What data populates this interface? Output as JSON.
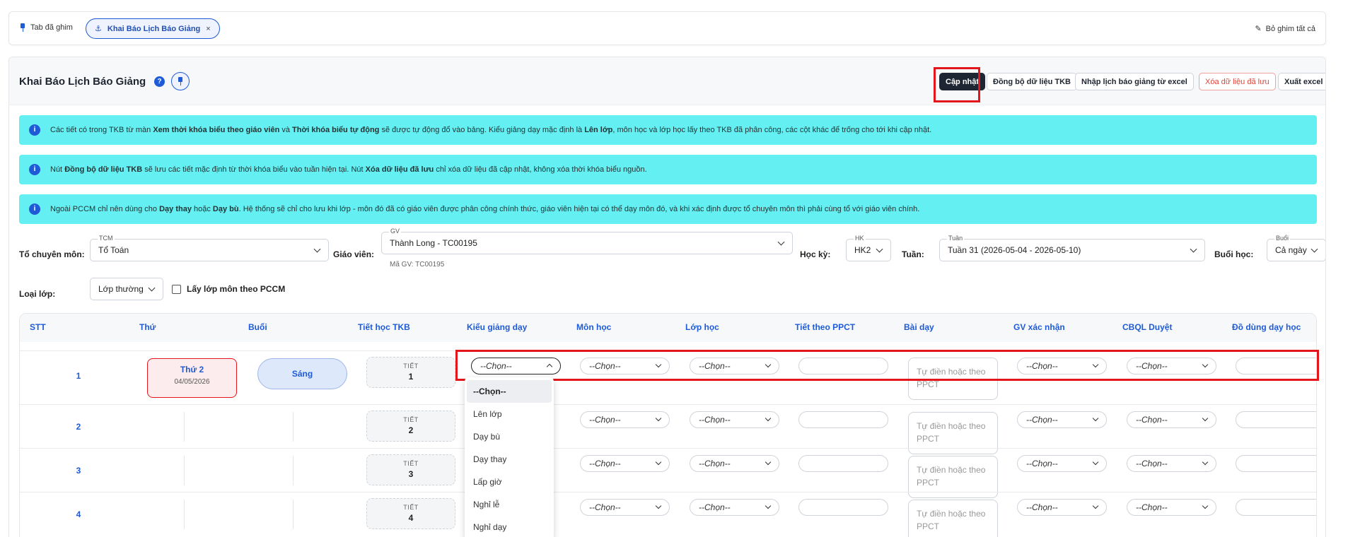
{
  "pinbar": {
    "label": "Tab đã ghim",
    "tab": "Khai Báo Lịch Báo Giảng",
    "tab_close": "×",
    "unpin_all": "Bỏ ghim tất cả"
  },
  "header": {
    "title": "Khai Báo Lịch Báo Giảng",
    "help": "?",
    "buttons": {
      "update": "Cập nhật",
      "sync": "Đồng bộ dữ liệu TKB",
      "import": "Nhập lịch báo giảng từ excel",
      "delete": "Xóa dữ liệu đã lưu",
      "export": "Xuất excel"
    }
  },
  "notices": [
    {
      "t1": "Các tiết có trong TKB từ màn ",
      "b1": "Xem thời khóa biểu theo giáo viên",
      "t2": " và ",
      "b2": "Thời khóa biểu tự động",
      "t3": " sẽ được tự động đổ vào bảng. Kiểu giảng dạy mặc định là ",
      "b3": "Lên lớp",
      "t4": ", môn học và lớp học lấy theo TKB đã phân công, các cột khác để trống cho tới khi cập nhật."
    },
    {
      "t1": "Nút ",
      "b1": "Đồng bộ dữ liệu TKB",
      "t2": " sẽ lưu các tiết mặc định từ thời khóa biểu vào tuần hiện tại. Nút ",
      "b2": "Xóa dữ liệu đã lưu",
      "t3": " chỉ xóa dữ liệu đã cập nhật, không xóa thời khóa biểu nguồn."
    },
    {
      "t1": "Ngoài PCCM chỉ nên dùng cho ",
      "b1": "Dạy thay",
      "t2": " hoặc ",
      "b2": "Dạy bù",
      "t3": ". Hệ thống sẽ chỉ cho lưu khi lớp - môn đó đã có giáo viên được phân công chính thức, giáo viên hiện tại có thể dạy môn đó, và khi xác định được tổ chuyên môn thì phải cùng tổ với giáo viên chính."
    }
  ],
  "filters": {
    "tcm_label": "Tổ chuyên môn:",
    "tcm_legend": "TCM",
    "tcm_value": "Tổ Toán",
    "gv_label": "Giáo viên:",
    "gv_legend": "GV",
    "gv_value": "Thành Long - TC00195",
    "gv_hint": "Mã GV: TC00195",
    "hk_label": "Học kỳ:",
    "hk_legend": "HK",
    "hk_value": "HK2",
    "tuan_label": "Tuần:",
    "tuan_legend": "Tuần",
    "tuan_value": "Tuần 31 (2026-05-04 - 2026-05-10)",
    "buoi_label": "Buổi học:",
    "buoi_legend": "Buổi",
    "buoi_value": "Cả ngày",
    "loai_label": "Loại lớp:",
    "loai_value": "Lớp thường",
    "pccm_check": "Lấy lớp môn theo PCCM"
  },
  "table": {
    "headers": [
      "STT",
      "Thứ",
      "Buổi",
      "Tiết học TKB",
      "Kiểu giảng dạy",
      "Môn học",
      "Lớp học",
      "Tiết theo PPCT",
      "Bài dạy",
      "GV xác nhận",
      "CBQL Duyệt",
      "Đồ dùng dạy học"
    ],
    "tiet_word": "TIẾT",
    "select_placeholder": "--Chọn--",
    "lesson_placeholder": "Tự điền hoặc theo PPCT",
    "rows": [
      {
        "stt": "1",
        "day": "Thứ 2",
        "date": "04/05/2026",
        "session": "Sáng",
        "tiet": "1"
      },
      {
        "stt": "2",
        "tiet": "2"
      },
      {
        "stt": "3",
        "tiet": "3"
      },
      {
        "stt": "4",
        "tiet": "4"
      }
    ]
  },
  "dropdown": {
    "options": [
      "--Chọn--",
      "Lên lớp",
      "Dạy bù",
      "Dạy thay",
      "Lấp giờ",
      "Nghỉ lễ",
      "Nghỉ dạy"
    ],
    "selected": "--Chọn--"
  },
  "colors": {
    "accent": "#1f5bd7",
    "notice_bg": "#64f0f3",
    "highlight": "#e2161b",
    "dark_button": "#1f2633"
  }
}
